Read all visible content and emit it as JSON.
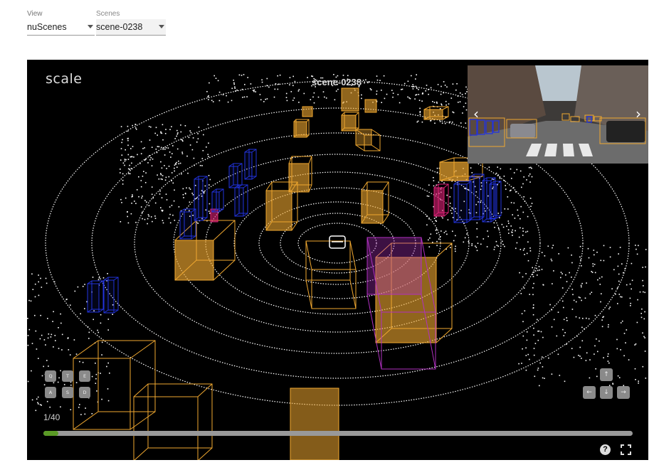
{
  "controls": {
    "view": {
      "label": "View",
      "value": "nuScenes"
    },
    "scenes": {
      "label": "Scenes",
      "value": "scene-0238"
    }
  },
  "viewer": {
    "logo": "scale",
    "scene_title": "scene-0238",
    "camera": {
      "prev_icon": "chevron-left-icon",
      "next_icon": "chevron-right-icon"
    },
    "keys_left": [
      "Q",
      "T",
      "E",
      "A",
      "S",
      "D"
    ],
    "keys_right": [
      "↑",
      "←",
      "↓",
      "→"
    ],
    "frame_counter": "1/40",
    "progress": {
      "current": 1,
      "total": 40
    },
    "colors": {
      "background": "#000000",
      "vehicle": "#f0a830",
      "pedestrian": "#2233dd",
      "cyclist": "#dd2277",
      "bus": "#b030c0",
      "timeline_fill": "#5a9a25",
      "point_cloud": "#ffffff"
    }
  }
}
